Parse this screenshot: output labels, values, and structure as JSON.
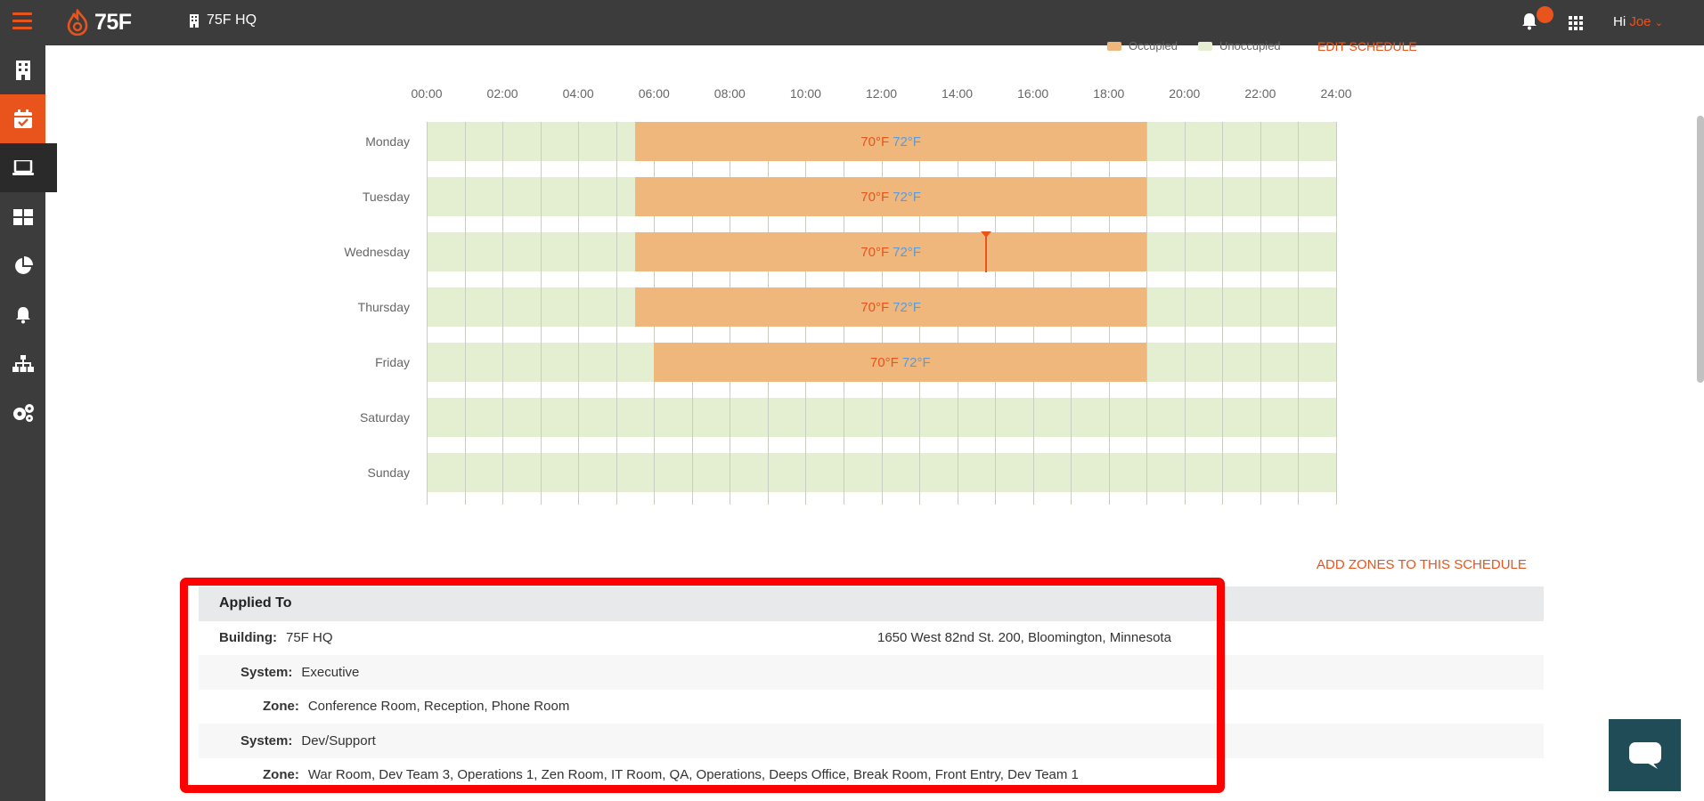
{
  "app": {
    "logo_text": "75F",
    "building": "75F HQ",
    "greeting_prefix": "Hi ",
    "user": "Joe"
  },
  "sidebar": {
    "items": [
      {
        "name": "building-icon"
      },
      {
        "name": "calendar-icon",
        "state": "active"
      },
      {
        "name": "laptop-icon",
        "state": "selected"
      },
      {
        "name": "dashboard-icon"
      },
      {
        "name": "pie-chart-icon"
      },
      {
        "name": "bell-icon"
      },
      {
        "name": "hierarchy-icon"
      },
      {
        "name": "settings-icon"
      }
    ]
  },
  "schedule": {
    "legend_occupied": "Occupied",
    "legend_unoccupied": "Unoccupied",
    "edit_label": "EDIT SCHEDULE",
    "hour_ticks": [
      "00:00",
      "02:00",
      "04:00",
      "06:00",
      "08:00",
      "10:00",
      "12:00",
      "14:00",
      "16:00",
      "18:00",
      "20:00",
      "22:00",
      "24:00"
    ],
    "days": [
      {
        "name": "Monday",
        "start": "05:30",
        "end": "19:00",
        "heat": "70°F",
        "cool": "72°F"
      },
      {
        "name": "Tuesday",
        "start": "05:30",
        "end": "19:00",
        "heat": "70°F",
        "cool": "72°F"
      },
      {
        "name": "Wednesday",
        "start": "05:30",
        "end": "19:00",
        "heat": "70°F",
        "cool": "72°F"
      },
      {
        "name": "Thursday",
        "start": "05:30",
        "end": "19:00",
        "heat": "70°F",
        "cool": "72°F"
      },
      {
        "name": "Friday",
        "start": "06:00",
        "end": "19:00",
        "heat": "70°F",
        "cool": "72°F"
      },
      {
        "name": "Saturday"
      },
      {
        "name": "Sunday"
      }
    ],
    "current_time": "14:45",
    "colors": {
      "occupied": "#f0b77d",
      "unoccupied": "#e4efd2",
      "heat": "#e8541c",
      "cool": "#5a9bd8"
    }
  },
  "applied": {
    "add_zones_label": "ADD ZONES TO THIS SCHEDULE",
    "header": "Applied To",
    "building_label": "Building:",
    "building_name": "75F HQ",
    "building_address": "1650 West 82nd St. 200, Bloomington, Minnesota",
    "systems": [
      {
        "label": "System:",
        "name": "Executive",
        "zone_label": "Zone:",
        "zones": "Conference Room, Reception, Phone Room"
      },
      {
        "label": "System:",
        "name": "Dev/Support",
        "zone_label": "Zone:",
        "zones": "War Room, Dev Team 3, Operations 1, Zen Room, IT Room, QA, Operations, Deeps Office, Break Room, Front Entry, Dev Team 1"
      }
    ]
  }
}
